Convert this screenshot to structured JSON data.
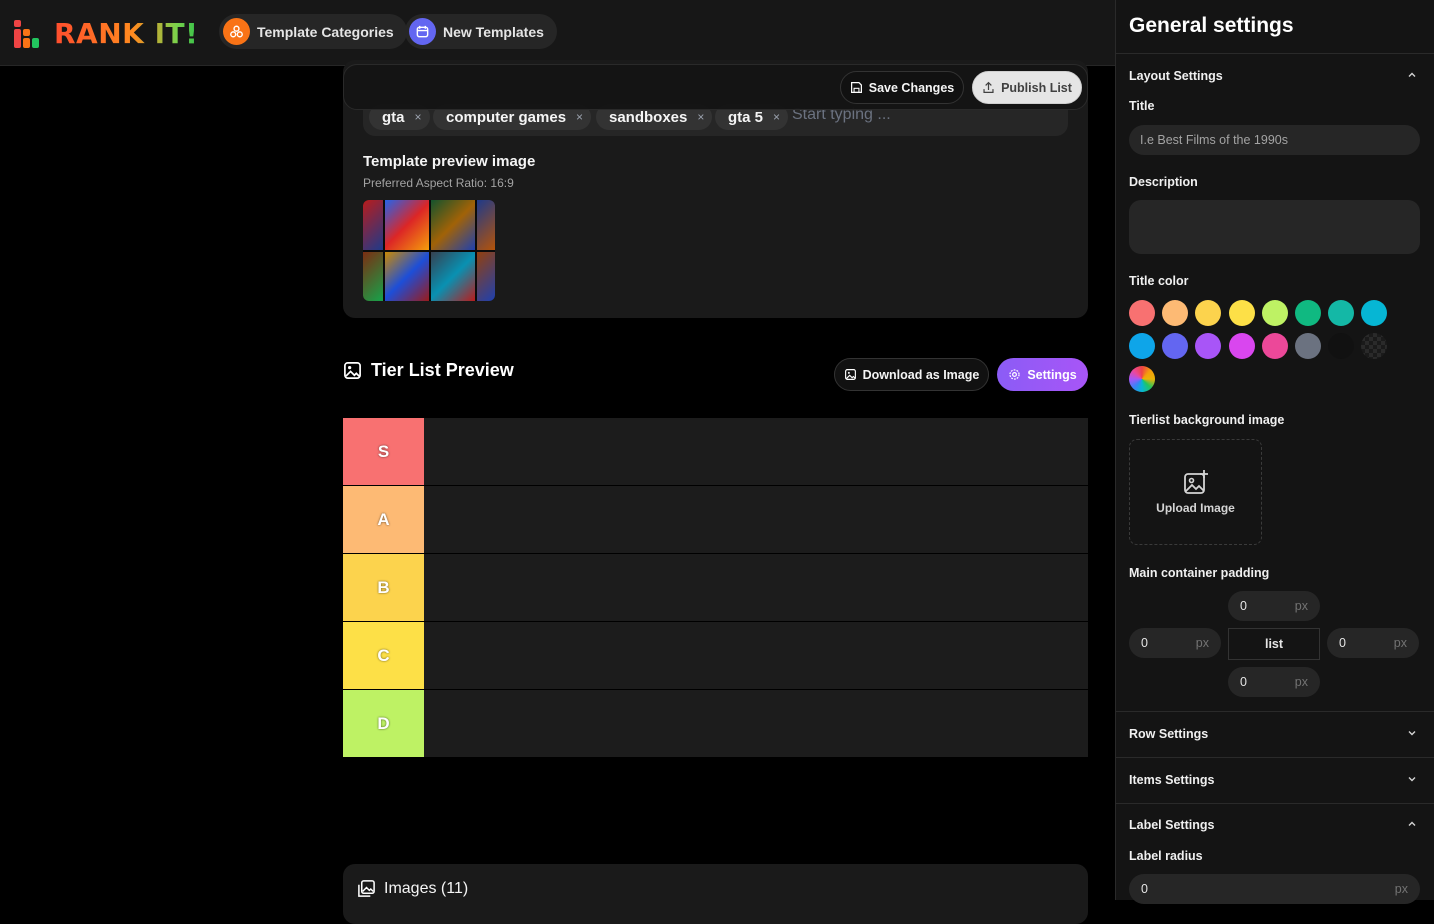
{
  "header": {
    "logo_text": "RANK IT!",
    "nav": [
      {
        "label": "Template Categories",
        "icon": "categories-icon"
      },
      {
        "label": "New Templates",
        "icon": "calendar-icon"
      }
    ]
  },
  "editor": {
    "save_label": "Save Changes",
    "publish_label": "Publish List",
    "tags": [
      "gta",
      "computer games",
      "sandboxes",
      "gta 5"
    ],
    "tag_remove": "×",
    "tag_placeholder": "Start typing ...",
    "preview_image_title": "Template preview image",
    "preview_image_hint": "Preferred Aspect Ratio: 16:9"
  },
  "tier_list": {
    "title": "Tier List Preview",
    "download_label": "Download as Image",
    "settings_label": "Settings",
    "rows": [
      {
        "label": "S",
        "color": "#f87171"
      },
      {
        "label": "A",
        "color": "#fdba74"
      },
      {
        "label": "B",
        "color": "#fcd34d"
      },
      {
        "label": "C",
        "color": "#fde047"
      },
      {
        "label": "D",
        "color": "#bef264"
      }
    ]
  },
  "images_section": {
    "title": "Images (11)"
  },
  "settings_panel": {
    "title": "General settings",
    "layout": {
      "heading": "Layout Settings",
      "title_label": "Title",
      "title_placeholder": "I.e Best Films of the 1990s",
      "description_label": "Description",
      "title_color_label": "Title color",
      "colors": [
        "#f87171",
        "#fdba74",
        "#fcd34d",
        "#fde047",
        "#bef264",
        "#10b981",
        "#14b8a6",
        "#06b6d4",
        "#0ea5e9",
        "#6366f1",
        "#a855f7",
        "#d946ef",
        "#ec4899",
        "#6b7280",
        "#111111",
        "checker",
        "rainbow"
      ],
      "bg_image_label": "Tierlist background image",
      "upload_label": "Upload Image",
      "padding_label": "Main container padding",
      "padding": {
        "top": "0",
        "left": "0",
        "right": "0",
        "bottom": "0",
        "unit": "px",
        "center": "list"
      }
    },
    "row_settings": "Row Settings",
    "items_settings": "Items Settings",
    "label_settings": {
      "heading": "Label Settings",
      "radius_label": "Label radius",
      "radius_value": "0",
      "unit": "px"
    }
  }
}
